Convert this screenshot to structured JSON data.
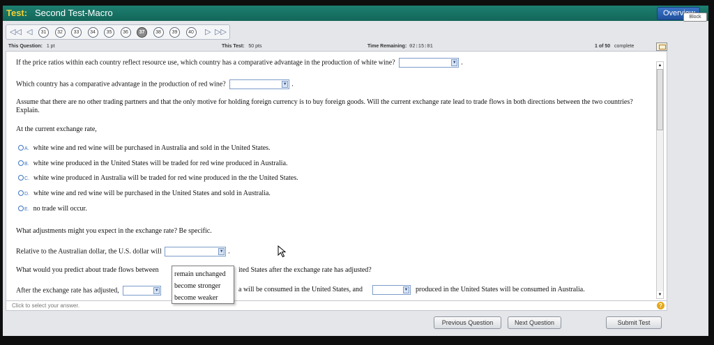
{
  "header": {
    "test_label": "Test:",
    "test_name": "Second Test-Macro",
    "overview_label": "Overview",
    "block_tooltip": "Block"
  },
  "nav": {
    "questions": [
      "31",
      "32",
      "33",
      "34",
      "35",
      "36",
      "37",
      "38",
      "39",
      "40"
    ],
    "current": "37"
  },
  "info": {
    "this_question_label": "This Question:",
    "this_question_value": "1 pt",
    "this_test_label": "This Test:",
    "this_test_value": "50 pts",
    "time_label": "Time Remaining:",
    "time_value": "02:15:01",
    "progress": "1 of 50",
    "progress_suffix": "complete"
  },
  "question": {
    "q1": "If the price ratios within each country reflect resource use, which country has a comparative advantage in the production of white wine?",
    "q2": "Which country has a comparative advantage in the production of red wine?",
    "q3": "Assume that there are no other trading partners and that the only motive for holding foreign currency  is to buy foreign goods.  Will the current exchange rate lead to trade flows in both directions between the two countries?  Explain.",
    "q4": "At the current exchange rate,",
    "options": [
      {
        "letter": "A.",
        "text": "white wine and red wine will be purchased in Australia and sold in the United States."
      },
      {
        "letter": "B.",
        "text": "white wine produced in the United States will be traded for red wine produced in Australia."
      },
      {
        "letter": "C.",
        "text": "white wine produced in Australia will be traded for red wine produced in the the United States."
      },
      {
        "letter": "D.",
        "text": "white wine and red wine will be purchased in the United States and sold in Australia."
      },
      {
        "letter": "E.",
        "text": "no trade will occur."
      }
    ],
    "q5": "What adjustments might you expect in the exchange rate?  Be specific.",
    "q6": "Relative to the Australian dollar, the U.S. dollar will",
    "q7_start": "What would you predict about trade flows between",
    "q7_end": "ited States after the exchange rate has adjusted?",
    "q8_start": "After the exchange rate has adjusted,",
    "q8_mid": "a will be consumed in the United States, and",
    "q8_end": "produced in the United States will be consumed in Australia."
  },
  "popup_options": [
    "remain unchanged",
    "become stronger",
    "become weaker"
  ],
  "status": {
    "hint": "Click to select your answer."
  },
  "buttons": {
    "previous": "Previous Question",
    "next": "Next Question",
    "submit": "Submit Test"
  }
}
